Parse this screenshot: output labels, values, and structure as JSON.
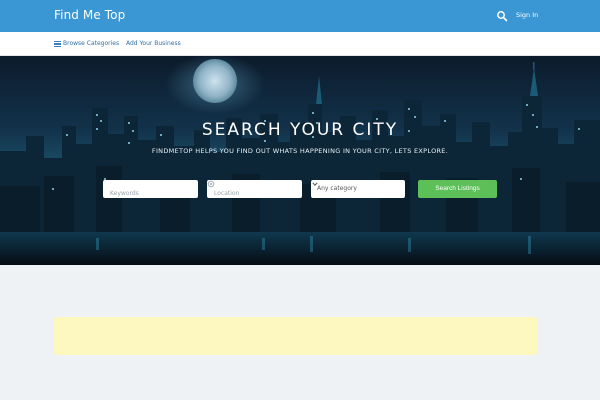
{
  "header": {
    "brand": "Find Me Top",
    "signin_label": "Sign In",
    "icons": {
      "search": "search-icon"
    }
  },
  "subnav": {
    "browse_label": "Browse Categories",
    "add_business_label": "Add Your Business",
    "icons": {
      "menu": "hamburger-icon"
    }
  },
  "hero": {
    "title": "SEARCH YOUR CITY",
    "subtitle": "FINDMETOP HELPS YOU FIND OUT WHATS HAPPENING IN YOUR CITY, LETS EXPLORE.",
    "search": {
      "keywords_placeholder": "Keywords",
      "location_placeholder": "Location",
      "category_value": "Any category",
      "submit_label": "Search Listings"
    }
  },
  "colors": {
    "topbar": "#3a97d4",
    "submit": "#5cbf58",
    "notice": "#fdf8bf",
    "page_background": "#eef2f5"
  }
}
